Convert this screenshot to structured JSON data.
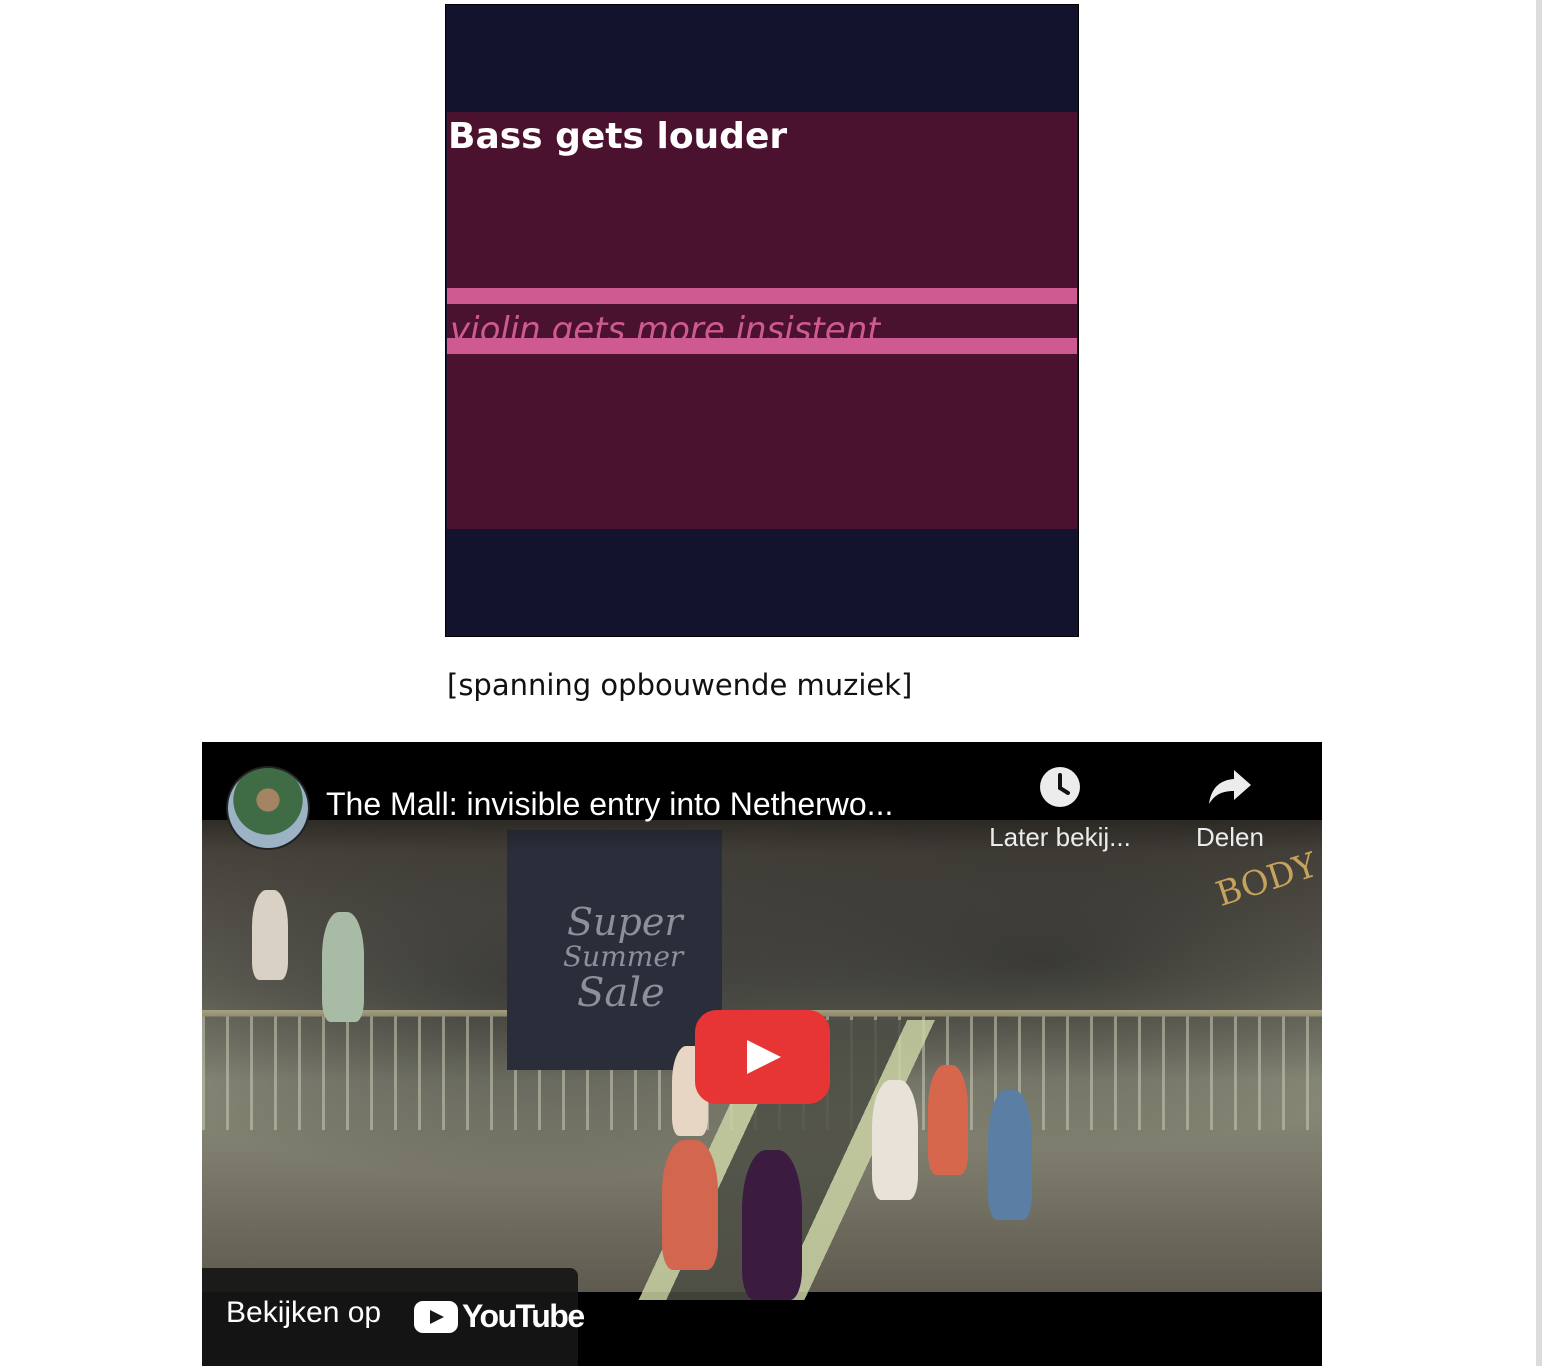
{
  "caption_visual": {
    "bass_text": "Bass gets louder",
    "violin_text": "violin gets more insistent",
    "colors": {
      "background": "#14132e",
      "band": "#4b1230",
      "accent": "#cf5a92",
      "bass_text": "#ffffff"
    }
  },
  "transcript": {
    "line": "[spanning opbouwende muziek]"
  },
  "video": {
    "title": "The Mall: invisible entry into Netherwo...",
    "watch_later_label": "Later bekij...",
    "share_label": "Delen",
    "watch_on_label": "Bekijken op",
    "platform_name": "YouTube",
    "thumbnail_banner": [
      "Super",
      "Summer",
      "Sale"
    ],
    "thumbnail_sign": "BODY",
    "icons": {
      "watch_later": "clock-icon",
      "share": "share-arrow-icon",
      "play": "play-icon",
      "logo": "youtube-logo-icon"
    },
    "colors": {
      "play_button": "#e73535"
    }
  }
}
